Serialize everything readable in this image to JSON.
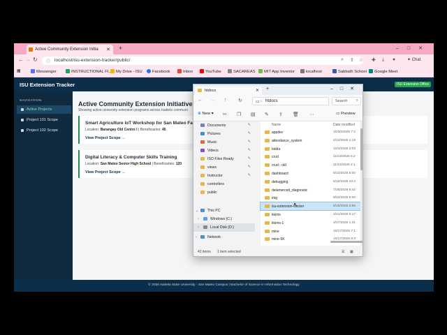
{
  "browser": {
    "tab_title": "Active Community Extension Initia",
    "url": "localhost/isu-extension-tracker/public/",
    "chat_label": "Chat",
    "bookmarks": [
      "Messenger",
      "INSTRUCTIONAL FI...",
      "My Drive - ISU",
      "Facebook",
      "Inbox",
      "YouTube",
      "SACAREAS",
      "MIT App Inventor",
      "localhost",
      "Sabbath School",
      "Google Meet"
    ]
  },
  "app": {
    "title": "ISU Extension Tracker",
    "office_badge": "ISU Extension Office",
    "sidebar": {
      "heading": "NAVIGATION",
      "items": [
        "Active Projects",
        "Project 101 Scope",
        "Project 102 Scope"
      ]
    },
    "page_title": "Active Community Extension Initiatives",
    "page_subtitle": "Showing active university extension programs across Isabela communi",
    "cards": [
      {
        "title": "Smart Agriculture IoT Workshop for San Mateo Farm",
        "location_label": "Location:",
        "location": "Barangay Old Centro I",
        "beneficiaries_label": "| Beneficiaries:",
        "beneficiaries": "45",
        "link": "View Project Scope →"
      },
      {
        "title": "Digital Literacy & Computer Skills Training",
        "location_label": "Location:",
        "location": "San Mateo Senior High School",
        "beneficiaries_label": "| Beneficiaries:",
        "beneficiaries": "120",
        "link": "View Project Scope →"
      }
    ],
    "footer": "© 2026 Isabela State University - San Mateo Campus | Bachelor of Science in Information Technology"
  },
  "explorer": {
    "tab_title": "htdocs",
    "path": "htdocs",
    "search_placeholder": "Search",
    "new_label": "New",
    "preview_label": "Preview",
    "nav_items": [
      {
        "label": "Documents",
        "icon": "documents-icon",
        "color": "#6a8ab5",
        "pinned": true
      },
      {
        "label": "Pictures",
        "icon": "pictures-icon",
        "color": "#3c8fd6",
        "pinned": true
      },
      {
        "label": "Music",
        "icon": "music-icon",
        "color": "#e0683a",
        "pinned": true
      },
      {
        "label": "Videos",
        "icon": "videos-icon",
        "color": "#8a4ad6",
        "pinned": true
      },
      {
        "label": "ISO Files Ready",
        "icon": "folder-icon",
        "color": "#e8b743",
        "pinned": true
      },
      {
        "label": "views",
        "icon": "folder-icon",
        "color": "#e8b743",
        "pinned": true
      },
      {
        "label": "Instructor",
        "icon": "folder-icon",
        "color": "#e8b743",
        "pinned": true
      },
      {
        "label": "controllers",
        "icon": "folder-icon",
        "color": "#e8b743",
        "pinned": false
      },
      {
        "label": "public",
        "icon": "folder-icon",
        "color": "#e8b743",
        "pinned": false
      }
    ],
    "this_pc": "This PC",
    "drives": [
      "Windows (C:)",
      "Local Disk (D:)"
    ],
    "network": "Network",
    "col_name": "Name",
    "col_date": "Date modified",
    "files": [
      {
        "name": "appdev",
        "date": "10/30/2025 7:2"
      },
      {
        "name": "attendance_system",
        "date": "4/14/2026 1:18"
      },
      {
        "name": "bidda",
        "date": "12/4/2025 2:03"
      },
      {
        "name": "crud",
        "date": "11/23/2025 5:2"
      },
      {
        "name": "crud - old",
        "date": "11/23/2025 2:1"
      },
      {
        "name": "dashboard",
        "date": "9/22/2025 5:00"
      },
      {
        "name": "debugging",
        "date": "6/10/2026 10:2"
      },
      {
        "name": "delamerced_diagnostic",
        "date": "7/28/2026 6:42"
      },
      {
        "name": "img",
        "date": "9/22/2025 5:00"
      },
      {
        "name": "isu-extension-tracker",
        "date": "6/15/2026 3:58"
      },
      {
        "name": "kkims",
        "date": "3/21/2026 5:17"
      },
      {
        "name": "kkims-1",
        "date": "3/17/2026 1:31"
      },
      {
        "name": "mine",
        "date": "10/17/2025 7:1"
      },
      {
        "name": "mine-5K",
        "date": "10/17/2025 8:3"
      }
    ],
    "item_count": "42 items",
    "selected_count": "1 item selected"
  }
}
